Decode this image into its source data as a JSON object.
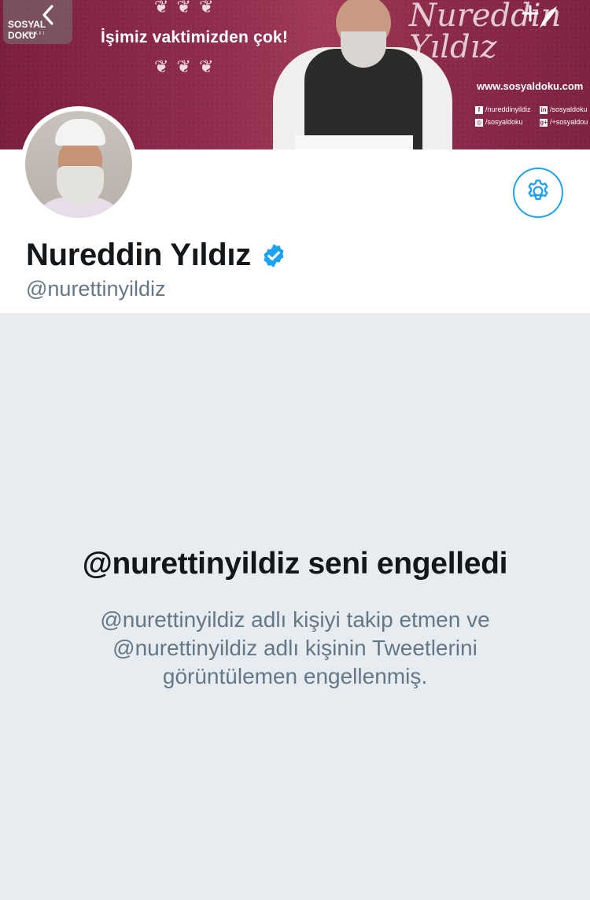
{
  "banner": {
    "tagline": "İşimiz vaktimizden çok!",
    "website": "www.sosyaldoku.com",
    "script_text": "Nureddin Yıldız",
    "logo_text": "SOSYAL DOKU",
    "logo_sub": "VAKFI",
    "social": [
      {
        "icon": "f",
        "label": "/nureddinyildiz"
      },
      {
        "icon": "in",
        "label": "/sosyaldoku"
      },
      {
        "icon": "◎",
        "label": "/sosyaldoku"
      },
      {
        "icon": "g+",
        "label": "/+sosyaldou"
      }
    ],
    "background_color": "#8e2c4c"
  },
  "toolbar": {
    "back_icon": "chevron-left-icon",
    "compose_icon": "compose-tweet-icon"
  },
  "profile": {
    "display_name": "Nureddin Yıldız",
    "handle": "@nurettinyildiz",
    "verified": true,
    "settings_icon": "gear-icon"
  },
  "blocked": {
    "title": "@nurettinyildiz seni engelledi",
    "description": "@nurettinyildiz adlı kişiyi takip etmen ve @nurettinyildiz adlı kişinin Tweetlerini görüntülemen engellenmiş."
  },
  "colors": {
    "accent": "#1da1f2",
    "text_primary": "#14171a",
    "text_secondary": "#657786",
    "page_background": "#e6ecf0"
  }
}
